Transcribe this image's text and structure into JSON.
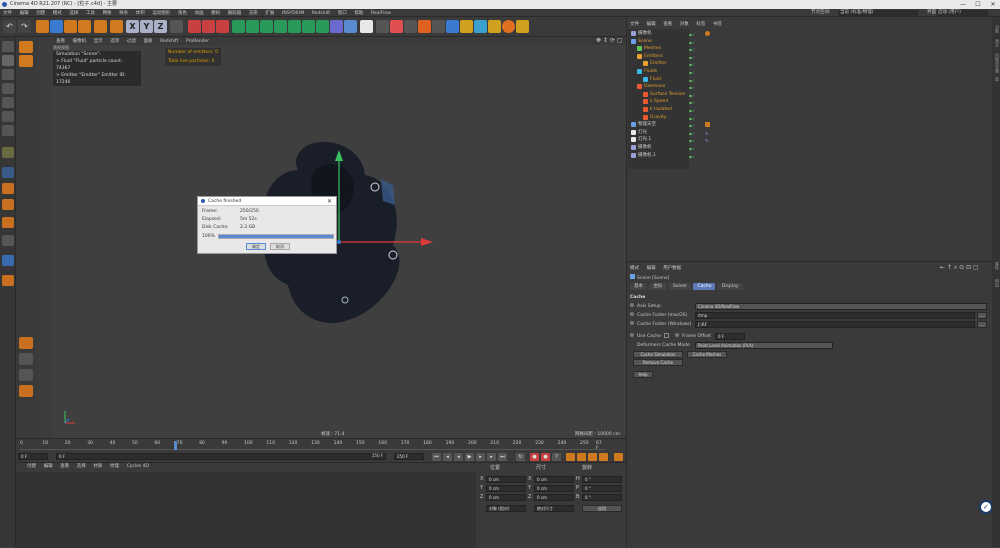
{
  "window": {
    "title": "Cinema 4D R21.207 (RC) - [粒子.c4d] - 主要",
    "min": "—",
    "max": "☐",
    "close": "✕"
  },
  "menubar": {
    "items": [
      "文件",
      "编辑",
      "创建",
      "模式",
      "选择",
      "工具",
      "网格",
      "样条",
      "体积",
      "运动图形",
      "角色",
      "动画",
      "模拟",
      "跟踪器",
      "渲染",
      "扩展",
      "INSYDIUM",
      "Redshift",
      "窗口",
      "帮助",
      "RealFlow"
    ]
  },
  "right_header": {
    "node_space": "节点空间:",
    "node_value": "当前 (标准/物理)",
    "layout_label": "界面:",
    "layout_value": "启动 (用户)"
  },
  "toolbar": {
    "axis": [
      "X",
      "Y",
      "Z"
    ]
  },
  "viewport": {
    "menu": [
      "查看",
      "摄像机",
      "显示",
      "选项",
      "过滤",
      "面板",
      "Redshift",
      "ProRender"
    ],
    "camera_label": "透视视图",
    "hud_lines": [
      "Simulation \"Scene\":",
      "> Fluid \"Fluid\" particle count: 74367",
      "> Emitter \"Emitter\" Emitter ID: 17246"
    ],
    "emitter_lines": [
      "Number of emitters: 0",
      "Total live particles: 0"
    ],
    "speed": "帧速 : 71.4",
    "grid": "网格间距 : 10000 cm",
    "axis_x": "X",
    "axis_y": "Y",
    "axis_z": "Z"
  },
  "dialog": {
    "title": "Cache finished",
    "rows": [
      {
        "label": "Frame:",
        "value": "250/250"
      },
      {
        "label": "Elapsed:",
        "value": "5m 52s"
      },
      {
        "label": "Disk Cache:",
        "value": "2.3 GB"
      }
    ],
    "percent": "100%",
    "progress": 1.0,
    "ok": "确定",
    "cancel": "取消"
  },
  "timeline": {
    "ticks": [
      "0",
      "10",
      "20",
      "30",
      "40",
      "50",
      "60",
      "70",
      "80",
      "90",
      "100",
      "110",
      "120",
      "130",
      "140",
      "150",
      "160",
      "170",
      "180",
      "190",
      "200",
      "210",
      "220",
      "230",
      "240",
      "250"
    ],
    "current": "67 F",
    "start": "0 F",
    "min": "0 F",
    "max": "250 F",
    "end": "250 F"
  },
  "bottom": {
    "tabs": [
      "创建",
      "编辑",
      "查看",
      "选择",
      "材质",
      "纹理",
      "Cycles 4D"
    ],
    "coord_headers": [
      "位置",
      "尺寸",
      "旋转"
    ],
    "coords": [
      {
        "axis": "X",
        "pos": "0 cm",
        "size": "0 cm",
        "rot_axis": "H",
        "rot": "0 °"
      },
      {
        "axis": "Y",
        "pos": "0 cm",
        "size": "0 cm",
        "rot_axis": "P",
        "rot": "0 °"
      },
      {
        "axis": "Z",
        "pos": "0 cm",
        "size": "0 cm",
        "rot_axis": "B",
        "rot": "0 °"
      }
    ],
    "mode1": "对象 (相对)",
    "mode2": "绝对尺寸",
    "apply": "应用"
  },
  "object_manager": {
    "menu": [
      "文件",
      "编辑",
      "查看",
      "对象",
      "标签",
      "书签"
    ],
    "items": [
      {
        "name": "摄像机",
        "indent": 0,
        "color": "#9aa0d8"
      },
      {
        "name": "Scene",
        "indent": 0,
        "color": "#6aa0e8"
      },
      {
        "name": "Meshes",
        "indent": 1,
        "color": "#5ac85a"
      },
      {
        "name": "Emitters",
        "indent": 1,
        "color": "#e8a030"
      },
      {
        "name": "Emitter",
        "indent": 2,
        "color": "#e8a030"
      },
      {
        "name": "Fluids",
        "indent": 1,
        "color": "#3ab8e8"
      },
      {
        "name": "Fluid",
        "indent": 2,
        "color": "#3ab8e8"
      },
      {
        "name": "Daemons",
        "indent": 1,
        "color": "#e85a30"
      },
      {
        "name": "Surface Tension",
        "indent": 2,
        "color": "#e85a30"
      },
      {
        "name": "k Speed",
        "indent": 2,
        "color": "#e85a30"
      },
      {
        "name": "k Isolated",
        "indent": 2,
        "color": "#e85a30"
      },
      {
        "name": "Gravity",
        "indent": 2,
        "color": "#e85a30"
      },
      {
        "name": "物理天空",
        "indent": 0,
        "color": "#6aa0e8"
      },
      {
        "name": "灯光",
        "indent": 0,
        "color": "#e8e8e8"
      },
      {
        "name": "灯光.1",
        "indent": 0,
        "color": "#e8e8e8"
      },
      {
        "name": "摄像机",
        "indent": 0,
        "color": "#9aa0d8"
      },
      {
        "name": "摄像机.1",
        "indent": 0,
        "color": "#9aa0d8"
      }
    ]
  },
  "attributes": {
    "menu": [
      "模式",
      "编辑",
      "用户数据"
    ],
    "object": "Scene [Scene]",
    "tabs": [
      "基本",
      "坐标",
      "Solver",
      "Cache",
      "Display"
    ],
    "active_tab": "Cache",
    "section": "Cache",
    "axis_setup_label": "Axis Setup",
    "axis_setup_value": "Cinema 4D/RealFlow",
    "folder_mac_label": "Cache Folder (macOS)",
    "folder_mac_value": "/tmp",
    "folder_win_label": "Cache Folder (Windows)",
    "folder_win_value": "J:\\RF",
    "browse": "...",
    "use_cache": "Use Cache",
    "frame_offset_label": "Frame Offset",
    "frame_offset_value": "0 F",
    "deformers_label": "Deformers Cache Mode",
    "deformers_value": "Point Level Animation (PLA)",
    "btn_cache_sim": "Cache Simulation",
    "btn_cache_mesh": "Cache Meshes",
    "btn_remove": "Remove Cache",
    "btn_help": "Help"
  },
  "side_tabs": [
    "对象",
    "场次",
    "内容浏览器",
    "层",
    "属性",
    "构造"
  ]
}
